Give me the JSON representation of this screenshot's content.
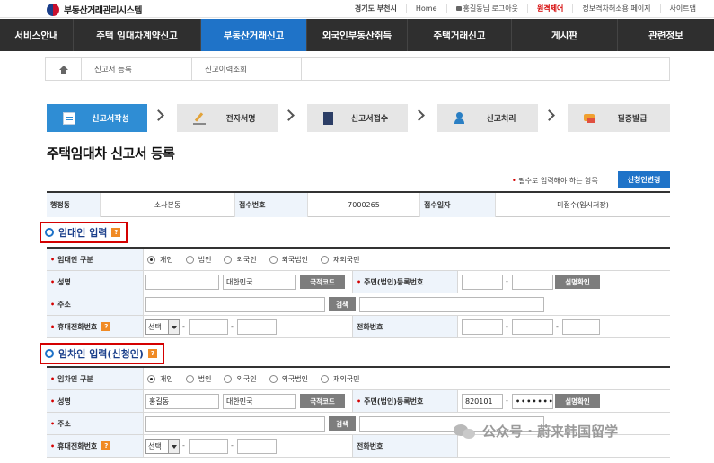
{
  "header": {
    "logo_text": "부동산거래관리시스템",
    "links": [
      "경기도 부천시",
      "Home",
      "홍길동님 로그아웃",
      "원격제어",
      "정보격차해소용 페이지",
      "사이트맵"
    ]
  },
  "nav": {
    "items": [
      "서비스안내",
      "주택 임대차계약신고",
      "부동산거래신고",
      "외국인부동산취득",
      "주택거래신고",
      "게시판",
      "관련정보"
    ],
    "active_index": 2
  },
  "breadcrumb": {
    "items": [
      "신고서 등록",
      "신고이력조회"
    ]
  },
  "steps": [
    "신고서작성",
    "전자서명",
    "신고서접수",
    "신고처리",
    "필증발급"
  ],
  "page": {
    "title": "주택임대차 신고서 등록",
    "required_note": "필수로 입력해야 하는 항목",
    "required_mark": "•",
    "change_applicant_button": "신청인변경"
  },
  "info": {
    "labels": [
      "행정동",
      "접수번호",
      "접수일자"
    ],
    "values": [
      "소사본동",
      "7000265",
      "미접수(임시저장)"
    ]
  },
  "common": {
    "star": "•",
    "help": "?",
    "dash": "-",
    "person_type_options": [
      "개인",
      "법인",
      "외국인",
      "외국법인",
      "재외국민"
    ],
    "nationality_button": "국적코드",
    "verify_button": "실명확인",
    "search_button": "검색",
    "select_label": "선택"
  },
  "lessor": {
    "title": "임대인 입력",
    "labels": {
      "type": "임대인 구분",
      "name": "성명",
      "id": "주민(법인)등록번호",
      "address": "주소",
      "mobile": "휴대전화번호",
      "phone": "전화번호"
    },
    "selected_type": 0,
    "name": "",
    "nationality": "대한민국",
    "id_front": "",
    "id_back": ""
  },
  "lessee": {
    "title": "임차인 입력(신청인)",
    "labels": {
      "type": "임차인 구분",
      "name": "성명",
      "id": "주민(법인)등록번호",
      "address": "주소",
      "mobile": "휴대전화번호",
      "phone": "전화번호"
    },
    "selected_type": 0,
    "name": "홍길동",
    "nationality": "대한민국",
    "id_front": "820101",
    "id_back": "•••••••"
  },
  "watermark": "公众号 · 蔚来韩国留学"
}
